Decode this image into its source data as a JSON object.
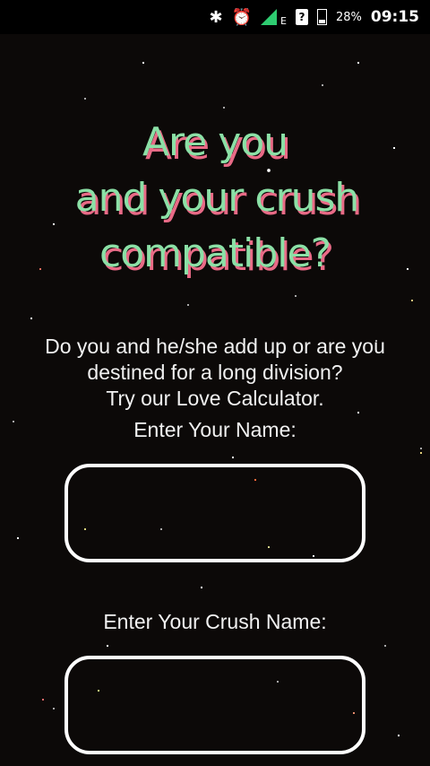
{
  "status_bar": {
    "icons": [
      "bluetooth-icon",
      "alarm-icon",
      "signal-icon",
      "network-type-icon",
      "unknown-sim-icon",
      "battery-icon"
    ],
    "network_type": "E",
    "unknown_icon_glyph": "?",
    "battery_percent": "28%",
    "time": "09:15",
    "signal_color": "#2ecc71"
  },
  "title": {
    "line1": "Are you",
    "line2": "and your crush",
    "line3": "compatible?",
    "fill_color": "#8be0a6",
    "shadow_color": "#e86a86"
  },
  "description": {
    "line1": "Do you and he/she add up or are you",
    "line2": "destined for a long division?",
    "line3": "Try our Love Calculator."
  },
  "form": {
    "name_label": "Enter Your Name:",
    "name_value": "",
    "crush_label": "Enter Your Crush Name:",
    "crush_value": ""
  }
}
